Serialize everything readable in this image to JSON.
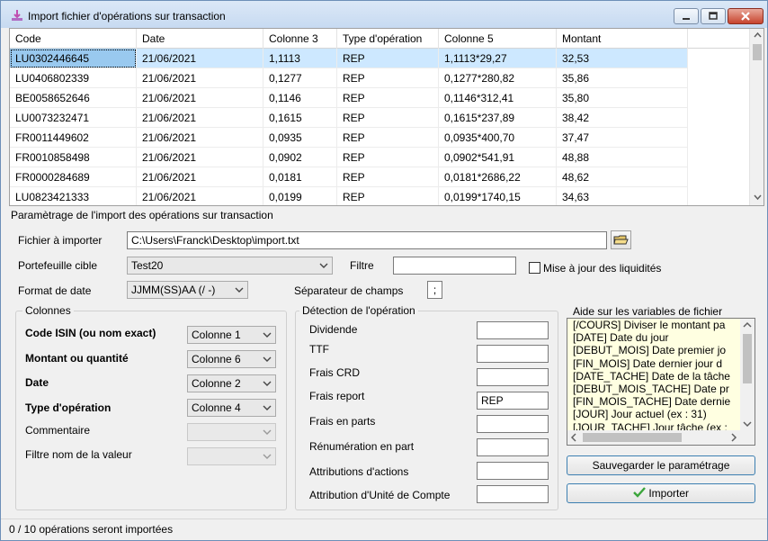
{
  "window": {
    "title": "Import fichier d'opérations sur transaction"
  },
  "grid": {
    "columns": [
      "Code",
      "Date",
      "Colonne 3",
      "Type d'opération",
      "Colonne 5",
      "Montant"
    ],
    "rows": [
      [
        "LU0302446645",
        "21/06/2021",
        "1,1113",
        "REP",
        "1,1113*29,27",
        "32,53"
      ],
      [
        "LU0406802339",
        "21/06/2021",
        "0,1277",
        "REP",
        "0,1277*280,82",
        "35,86"
      ],
      [
        "BE0058652646",
        "21/06/2021",
        "0,1146",
        "REP",
        "0,1146*312,41",
        "35,80"
      ],
      [
        "LU0073232471",
        "21/06/2021",
        "0,1615",
        "REP",
        "0,1615*237,89",
        "38,42"
      ],
      [
        "FR0011449602",
        "21/06/2021",
        "0,0935",
        "REP",
        "0,0935*400,70",
        "37,47"
      ],
      [
        "FR0010858498",
        "21/06/2021",
        "0,0902",
        "REP",
        "0,0902*541,91",
        "48,88"
      ],
      [
        "FR0000284689",
        "21/06/2021",
        "0,0181",
        "REP",
        "0,0181*2686,22",
        "48,62"
      ],
      [
        "LU0823421333",
        "21/06/2021",
        "0,0199",
        "REP",
        "0,0199*1740,15",
        "34,63"
      ]
    ]
  },
  "settings": {
    "section_title": "Paramètrage de l'import des opérations sur transaction",
    "file_label": "Fichier à importer",
    "file_value": "C:\\Users\\Franck\\Desktop\\import.txt",
    "portfolio_label": "Portefeuille cible",
    "portfolio_value": "Test20",
    "filter_label": "Filtre",
    "filter_value": "",
    "update_liquidity_label": "Mise à jour des liquidités",
    "date_format_label": "Format de date",
    "date_format_value": "JJMM(SS)AA (/ -)",
    "separator_label": "Séparateur de champs",
    "separator_value": ";"
  },
  "columns_group": {
    "title": "Colonnes",
    "isin_label": "Code ISIN (ou nom exact)",
    "isin_value": "Colonne 1",
    "amount_label": "Montant ou quantité",
    "amount_value": "Colonne 6",
    "date_label": "Date",
    "date_value": "Colonne 2",
    "type_label": "Type d'opération",
    "type_value": "Colonne 4",
    "comment_label": "Commentaire",
    "comment_value": "",
    "filter_name_label": "Filtre nom de la valeur",
    "filter_name_value": ""
  },
  "detection_group": {
    "title": "Détection de l'opération",
    "fields": [
      {
        "label": "Dividende",
        "value": ""
      },
      {
        "label": "TTF",
        "value": ""
      },
      {
        "label": "Frais CRD",
        "value": ""
      },
      {
        "label": "Frais report",
        "value": "REP"
      },
      {
        "label": "Frais en parts",
        "value": ""
      },
      {
        "label": "Rénumération en part",
        "value": ""
      },
      {
        "label": "Attributions d'actions",
        "value": ""
      },
      {
        "label": "Attribution d'Unité de Compte",
        "value": ""
      }
    ]
  },
  "help": {
    "title": "Aide sur les variables de fichier",
    "lines": [
      "[/COURS] Diviser le montant pa",
      "[DATE] Date du jour",
      "[DEBUT_MOIS] Date premier jo",
      "[FIN_MOIS] Date dernier jour d",
      "[DATE_TACHE] Date de la tâche",
      "[DEBUT_MOIS_TACHE] Date pr",
      "[FIN_MOIS_TACHE] Date dernie",
      "[JOUR] Jour actuel (ex : 31)",
      "[JOUR_TACHE] Jour tâche (ex :"
    ]
  },
  "buttons": {
    "save": "Sauvegarder le paramétrage",
    "import": "Importer"
  },
  "status": {
    "text": "0 / 10 opérations seront importées"
  }
}
